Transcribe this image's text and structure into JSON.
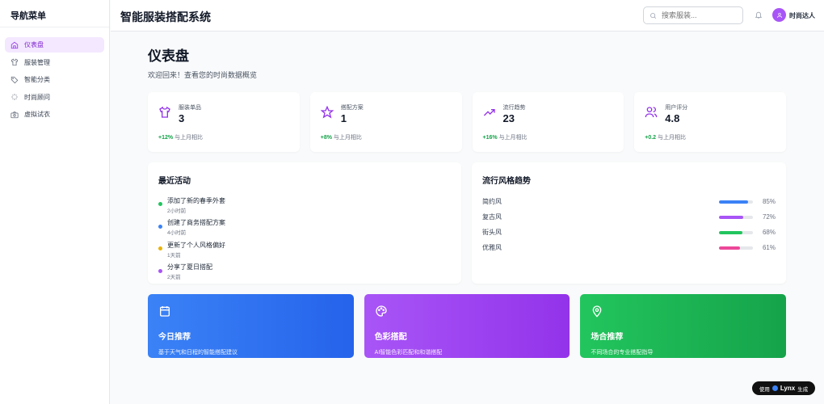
{
  "sidebar": {
    "title": "导航菜单",
    "items": [
      {
        "label": "仪表盘",
        "icon": "home-icon",
        "active": true
      },
      {
        "label": "服装管理",
        "icon": "shirt-icon"
      },
      {
        "label": "智能分类",
        "icon": "tag-icon"
      },
      {
        "label": "时尚顾问",
        "icon": "sparkles-icon"
      },
      {
        "label": "虚拟试衣",
        "icon": "camera-icon"
      }
    ]
  },
  "header": {
    "title": "智能服装搭配系统",
    "search_placeholder": "搜索服装...",
    "user": "时尚达人"
  },
  "page": {
    "title": "仪表盘",
    "subtitle": "欢迎回来！查看您的时尚数据概览"
  },
  "stats": [
    {
      "label": "服装单品",
      "value": "3",
      "change": "+12%",
      "suffix": "与上月相比",
      "icon": "shirt-icon"
    },
    {
      "label": "搭配方案",
      "value": "1",
      "change": "+8%",
      "suffix": "与上月相比",
      "icon": "star-icon"
    },
    {
      "label": "流行趋势",
      "value": "23",
      "change": "+16%",
      "suffix": "与上月相比",
      "icon": "trending-up-icon"
    },
    {
      "label": "用户评分",
      "value": "4.8",
      "change": "+0.2",
      "suffix": "与上月相比",
      "icon": "users-icon"
    }
  ],
  "activity": {
    "title": "最近活动",
    "items": [
      {
        "text": "添加了新的春季外套",
        "time": "2小时前",
        "color": "#22c55e"
      },
      {
        "text": "创建了商务搭配方案",
        "time": "4小时前",
        "color": "#3b82f6"
      },
      {
        "text": "更新了个人风格偏好",
        "time": "1天前",
        "color": "#eab308"
      },
      {
        "text": "分享了夏日搭配",
        "time": "2天前",
        "color": "#a855f7"
      }
    ]
  },
  "trends": {
    "title": "流行风格趋势",
    "items": [
      {
        "name": "简约风",
        "value": 85,
        "label": "85%",
        "color": "#3b82f6"
      },
      {
        "name": "复古风",
        "value": 72,
        "label": "72%",
        "color": "#a855f7"
      },
      {
        "name": "街头风",
        "value": 68,
        "label": "68%",
        "color": "#22c55e"
      },
      {
        "name": "优雅风",
        "value": 61,
        "label": "61%",
        "color": "#ec4899"
      }
    ]
  },
  "features": [
    {
      "title": "今日推荐",
      "desc": "基于天气和日程的智能搭配建议",
      "icon": "calendar-icon",
      "from": "#3b82f6",
      "to": "#2563eb"
    },
    {
      "title": "色彩搭配",
      "desc": "AI智能色彩匹配和和谐搭配",
      "icon": "palette-icon",
      "from": "#a855f7",
      "to": "#9333ea"
    },
    {
      "title": "场合推荐",
      "desc": "不同场合的专业搭配指导",
      "icon": "map-pin-icon",
      "from": "#22c55e",
      "to": "#16a34a"
    }
  ],
  "badge": {
    "prefix": "使用",
    "brand": "Lynx",
    "suffix": "生成"
  }
}
